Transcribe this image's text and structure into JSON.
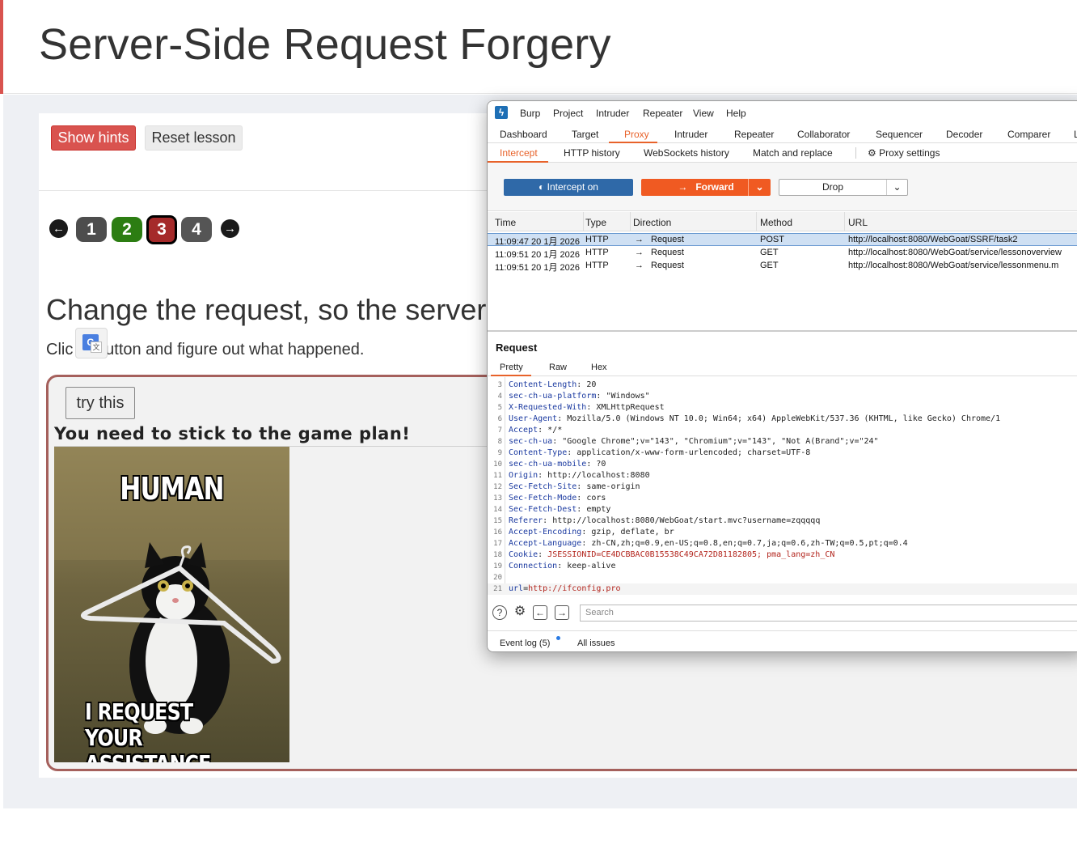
{
  "page": {
    "title": "Server-Side Request Forgery",
    "show_hints": "Show hints",
    "reset_lesson": "Reset lesson",
    "pages": [
      "1",
      "2",
      "3",
      "4"
    ],
    "current_page": "3",
    "heading": "Change the request, so the server",
    "sub_start": "Clic",
    "sub_end": "e button and figure out what happened.",
    "try_button": "try this",
    "game_plan": "You need to stick to the game plan!",
    "meme_top": "HUMAN",
    "meme_bottom_1": "I REQUEST YOUR",
    "meme_bottom_2": "ASSISTANCE",
    "colors": {
      "hints": "#d9534f",
      "page1": "#4d4d4d",
      "page2": "#2c7d12",
      "page3": "#a52a2a",
      "page4": "#555555"
    }
  },
  "burp": {
    "menu": [
      "Burp",
      "Project",
      "Intruder",
      "Repeater",
      "View",
      "Help"
    ],
    "tabs": [
      "Dashboard",
      "Target",
      "Proxy",
      "Intruder",
      "Repeater",
      "Collaborator",
      "Sequencer",
      "Decoder",
      "Comparer",
      "L"
    ],
    "active_tab": "Proxy",
    "subtabs": [
      "Intercept",
      "HTTP history",
      "WebSockets history",
      "Match and replace"
    ],
    "proxy_settings": "Proxy settings",
    "intercept_btn": "Intercept on",
    "forward_btn": "Forward",
    "drop_btn": "Drop",
    "columns": [
      "Time",
      "Type",
      "Direction",
      "Method",
      "URL"
    ],
    "rows": [
      {
        "time": "11:09:47 20 1月 2026",
        "type": "HTTP",
        "direction": "Request",
        "method": "POST",
        "url": "http://localhost:8080/WebGoat/SSRF/task2"
      },
      {
        "time": "11:09:51 20 1月 2026",
        "type": "HTTP",
        "direction": "Request",
        "method": "GET",
        "url": "http://localhost:8080/WebGoat/service/lessonoverview"
      },
      {
        "time": "11:09:51 20 1月 2026",
        "type": "HTTP",
        "direction": "Request",
        "method": "GET",
        "url": "http://localhost:8080/WebGoat/service/lessonmenu.m"
      }
    ],
    "request_title": "Request",
    "view_tabs": [
      "Pretty",
      "Raw",
      "Hex"
    ],
    "request_lines": [
      {
        "n": "3",
        "k": "Content-Length",
        "v": " 20"
      },
      {
        "n": "4",
        "k": "sec-ch-ua-platform",
        "v": " \"Windows\""
      },
      {
        "n": "5",
        "k": "X-Requested-With",
        "v": " XMLHttpRequest"
      },
      {
        "n": "6",
        "k": "User-Agent",
        "v": " Mozilla/5.0 (Windows NT 10.0; Win64; x64) AppleWebKit/537.36 (KHTML, like Gecko) Chrome/1"
      },
      {
        "n": "7",
        "k": "Accept",
        "v": " */*"
      },
      {
        "n": "8",
        "k": "sec-ch-ua",
        "v": " \"Google Chrome\";v=\"143\", \"Chromium\";v=\"143\", \"Not A(Brand\";v=\"24\""
      },
      {
        "n": "9",
        "k": "Content-Type",
        "v": " application/x-www-form-urlencoded; charset=UTF-8"
      },
      {
        "n": "10",
        "k": "sec-ch-ua-mobile",
        "v": " ?0"
      },
      {
        "n": "11",
        "k": "Origin",
        "v": " http://localhost:8080"
      },
      {
        "n": "12",
        "k": "Sec-Fetch-Site",
        "v": " same-origin"
      },
      {
        "n": "13",
        "k": "Sec-Fetch-Mode",
        "v": " cors"
      },
      {
        "n": "14",
        "k": "Sec-Fetch-Dest",
        "v": " empty"
      },
      {
        "n": "15",
        "k": "Referer",
        "v": " http://localhost:8080/WebGoat/start.mvc?username=zqqqqq"
      },
      {
        "n": "16",
        "k": "Accept-Encoding",
        "v": " gzip, deflate, br"
      },
      {
        "n": "17",
        "k": "Accept-Language",
        "v": " zh-CN,zh;q=0.9,en-US;q=0.8,en;q=0.7,ja;q=0.6,zh-TW;q=0.5,pt;q=0.4"
      },
      {
        "n": "18",
        "k": "Cookie",
        "v": " JSESSIONID=CE4DCBBAC0B15538C49CA72D81182805; pma_lang=zh_CN"
      },
      {
        "n": "19",
        "k": "Connection",
        "v": " keep-alive"
      },
      {
        "n": "20",
        "k": "",
        "v": ""
      }
    ],
    "body_line": {
      "n": "21",
      "k": "url",
      "v": "http://ifconfig.pro"
    },
    "search_placeholder": "Search",
    "event_log": "Event log (5)",
    "all_issues": "All issues"
  }
}
